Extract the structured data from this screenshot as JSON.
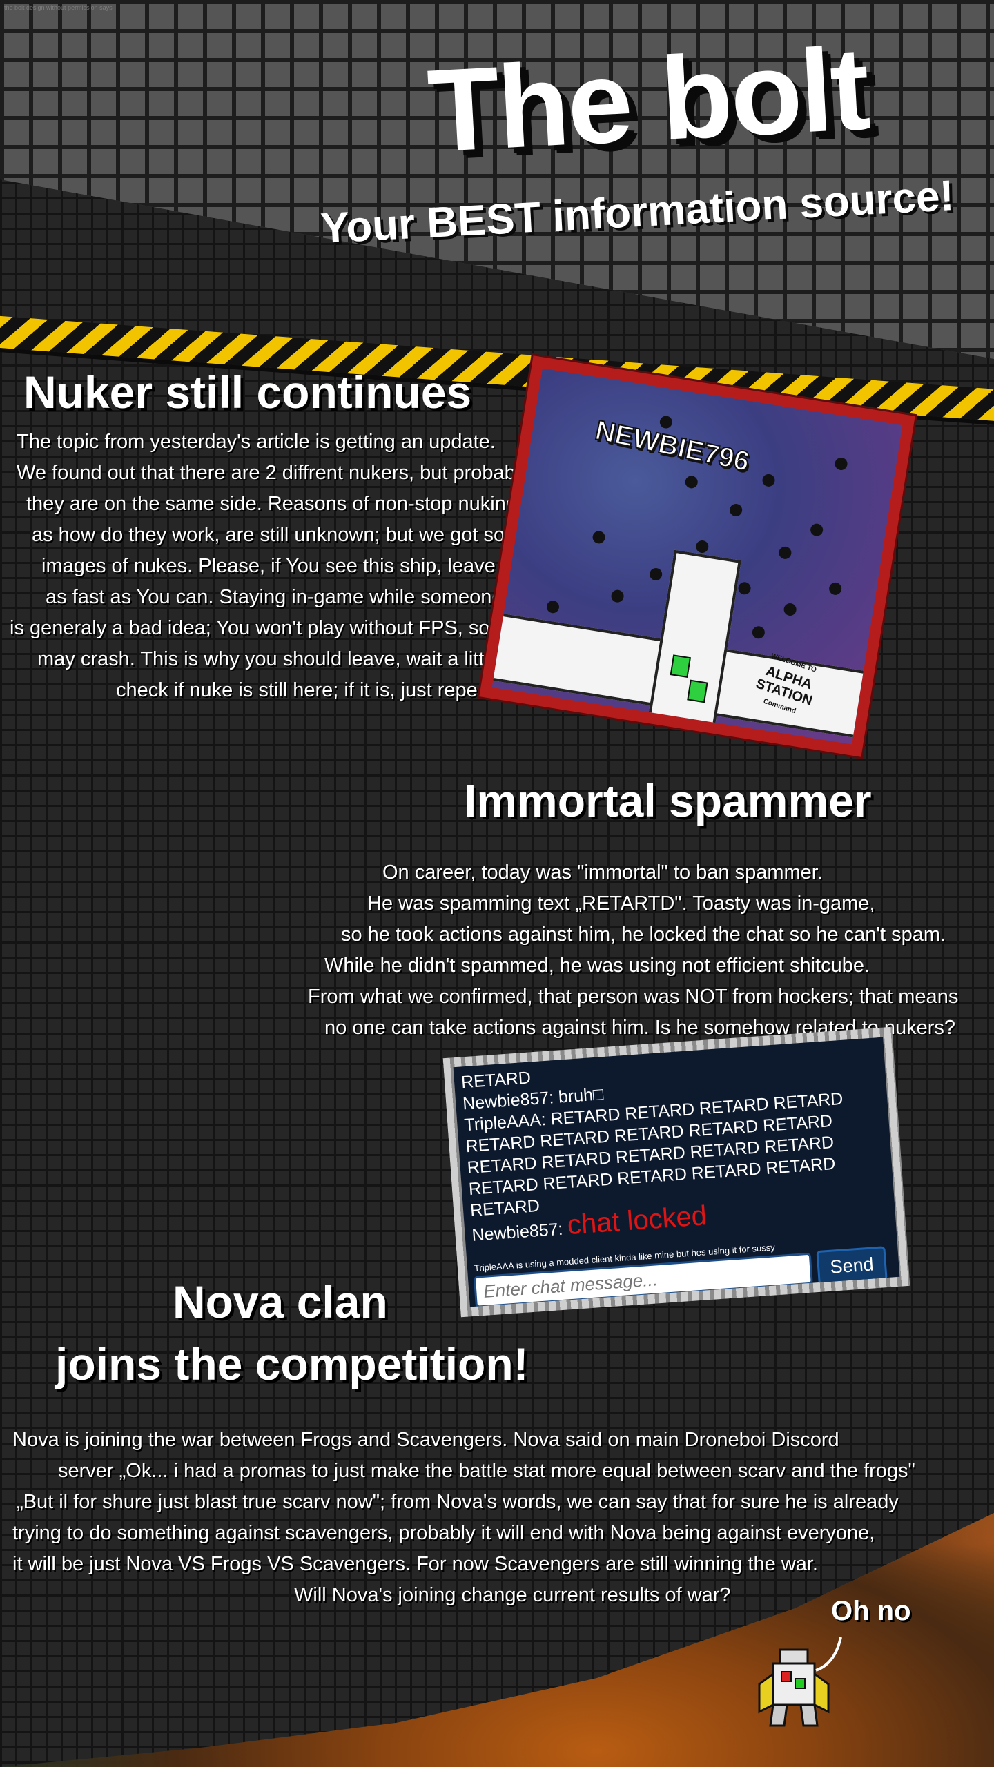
{
  "watermark": "the bolt design without permission says",
  "header": {
    "title": "The bolt",
    "subtitle": "Your BEST information source!"
  },
  "articles": [
    {
      "heading": "Nuker still continues",
      "lines": [
        "The topic from yesterday's article is getting an update.",
        "We found out that there are 2 diffrent nukers, but probably",
        "they are on the same side. Reasons of non-stop nuking,",
        "as how do they work, are still unknown; but we got some",
        "images of nukes. Please, if You see this ship, leave the game",
        "as fast as You can. Staying in-game while someone is nuking,",
        "is generaly a bad idea; You won't play without FPS, some old devices",
        "may crash. This is why you should leave, wait a little bit of time,",
        "check if nuke is still here; if it is, just repeat."
      ]
    },
    {
      "heading": "Immortal spammer",
      "lines": [
        "On career, today was \"immortal\" to ban spammer.",
        "He was spamming text „RETARTD\". Toasty was in-game,",
        "so he took actions against him, he locked the chat so he can't spam.",
        "While he didn't spammed, he was using not efficient shitcube.",
        "From what we confirmed, that person was NOT from hockers; that means",
        "no one can take actions against him. Is he somehow related to nukers?"
      ]
    },
    {
      "heading_line1": "Nova clan",
      "heading_line2": "joins the competition!",
      "lines": [
        "Nova is joining the war between Frogs and Scavengers. Nova said on main Droneboi Discord",
        "server „Ok... i had a promas to just make the battle stat more equal between scarv and the frogs\"",
        "„But il for shure just blast true scarv now\"; from Nova's words, we can say that for sure he is already",
        "trying to do something against scavengers, probably it will end with Nova being against everyone,",
        "it will be just Nova VS Frogs VS Scavengers. For now Scavengers are still winning the war.",
        "Will Nova's joining change current results of war?"
      ]
    }
  ],
  "nuke_image": {
    "nickname": "NEWBIE796",
    "sign_small": "WELCOME TO",
    "sign_main1": "ALPHA",
    "sign_main2": "STATION",
    "sign_sub": "Command"
  },
  "chat": {
    "lines": [
      "RETARD",
      "Newbie857: bruh□",
      "TripleAAA: RETARD RETARD RETARD RETARD",
      "RETARD RETARD RETARD RETARD RETARD",
      "RETARD RETARD RETARD RETARD RETARD",
      "RETARD RETARD RETARD RETARD RETARD",
      "RETARD"
    ],
    "locked_prefix": "Newbie857: ",
    "locked_text": "chat locked",
    "note": "TripleAAA is using a modded client kinda like mine but hes using it for sussy",
    "input_placeholder": "Enter chat message...",
    "send_label": "Send"
  },
  "caption": "Oh no",
  "colors": {
    "hazard_yellow": "#f2c400",
    "frame_red": "#b51d1d",
    "chat_bg": "#0d1a2e",
    "locked_red": "#e01414"
  }
}
